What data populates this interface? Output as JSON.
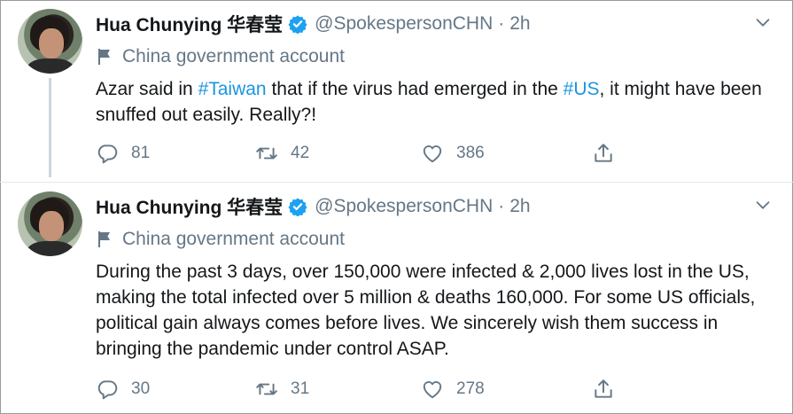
{
  "tweets": [
    {
      "author_name": "Hua Chunying 华春莹",
      "handle": "@SpokespersonCHN",
      "separator": "·",
      "time": "2h",
      "label": "China government account",
      "text_parts": {
        "p1": "Azar said in ",
        "h1": "#Taiwan",
        "p2": " that if the virus had emerged in the ",
        "h2": "#US",
        "p3": ", it might have been snuffed out easily. Really?!"
      },
      "replies": "81",
      "retweets": "42",
      "likes": "386"
    },
    {
      "author_name": "Hua Chunying 华春莹",
      "handle": "@SpokespersonCHN",
      "separator": "·",
      "time": "2h",
      "label": "China government account",
      "text": "During the past 3 days, over 150,000 were infected & 2,000 lives lost in the US, making the total infected over 5 million & deaths 160,000. For some US officials, political gain always comes before lives. We sincerely wish them success in bringing the pandemic under control ASAP.",
      "replies": "30",
      "retweets": "31",
      "likes": "278"
    }
  ],
  "colors": {
    "verified_badge": "#1da1f2",
    "hashtag": "#1b95e0",
    "secondary_text": "#657786",
    "thread_line": "#ccd6dd"
  },
  "icons": {
    "verified": "verified-badge-icon",
    "caret": "chevron-down-icon",
    "label": "flag-icon",
    "reply": "reply-icon",
    "retweet": "retweet-icon",
    "like": "heart-icon",
    "share": "share-icon"
  }
}
